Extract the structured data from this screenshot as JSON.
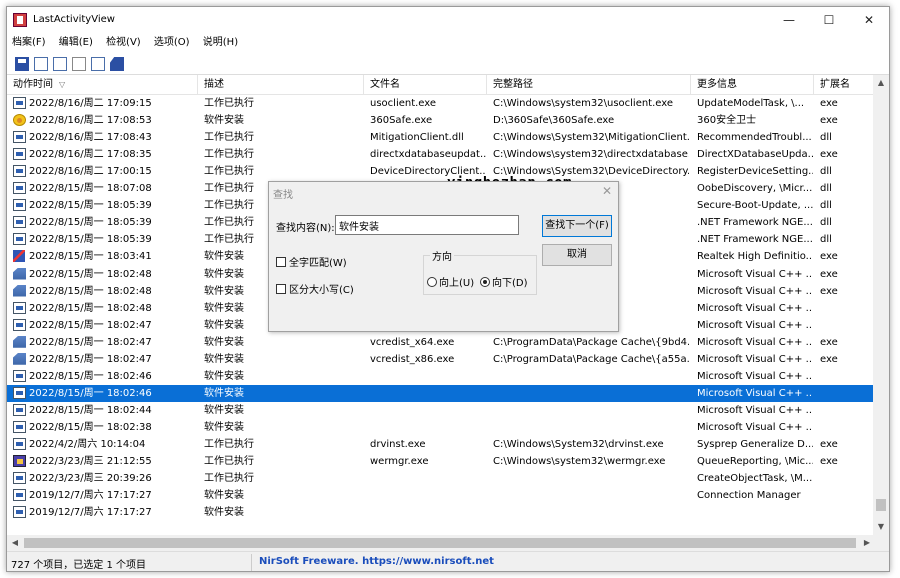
{
  "app": {
    "title": "LastActivityView"
  },
  "window_controls": {
    "minimize": "—",
    "maximize": "☐",
    "close": "✕"
  },
  "menu": [
    "档案(F)",
    "编辑(E)",
    "检视(V)",
    "选项(O)",
    "说明(H)"
  ],
  "toolbar": {
    "icons": [
      "save-icon",
      "properties-icon",
      "copy-icon",
      "html-report-icon",
      "export-icon",
      "exit-icon"
    ]
  },
  "columns": [
    "动作时间",
    "描述",
    "文件名",
    "完整路径",
    "更多信息",
    "扩展名"
  ],
  "sort_indicator": "▽",
  "rows": [
    {
      "icon": "app",
      "time": "2022/8/16/周二 17:09:15",
      "desc": "工作已执行",
      "file": "usoclient.exe",
      "path": "C:\\Windows\\system32\\usoclient.exe",
      "info": "UpdateModelTask, \\...",
      "ext": "exe"
    },
    {
      "icon": "s360",
      "time": "2022/8/16/周二 17:08:53",
      "desc": "软件安装",
      "file": "360Safe.exe",
      "path": "D:\\360Safe\\360Safe.exe",
      "info": "360安全卫士",
      "ext": "exe"
    },
    {
      "icon": "app",
      "time": "2022/8/16/周二 17:08:43",
      "desc": "工作已执行",
      "file": "MitigationClient.dll",
      "path": "C:\\Windows\\System32\\MitigationClient...",
      "info": "RecommendedTroubl...",
      "ext": "dll"
    },
    {
      "icon": "app",
      "time": "2022/8/16/周二 17:08:35",
      "desc": "工作已执行",
      "file": "directxdatabaseupdat...",
      "path": "C:\\Windows\\system32\\directxdatabase...",
      "info": "DirectXDatabaseUpda...",
      "ext": "exe"
    },
    {
      "icon": "app",
      "time": "2022/8/16/周二 17:00:15",
      "desc": "工作已执行",
      "file": "DeviceDirectoryClient...",
      "path": "C:\\Windows\\System32\\DeviceDirectory...",
      "info": "RegisterDeviceSetting...",
      "ext": "dll"
    },
    {
      "icon": "app",
      "time": "2022/8/15/周一 18:07:08",
      "desc": "工作已执行",
      "file": "",
      "path": "BMediaMana...",
      "info": "OobeDiscovery, \\Micr...",
      "ext": "dll"
    },
    {
      "icon": "app",
      "time": "2022/8/15/周一 18:05:39",
      "desc": "工作已执行",
      "file": "",
      "path": "mTasks.dll",
      "info": "Secure-Boot-Update, ...",
      "ext": "dll"
    },
    {
      "icon": "app",
      "time": "2022/8/15/周一 18:05:39",
      "desc": "工作已执行",
      "file": "",
      "path": "scoree.dll",
      "info": ".NET Framework NGE...",
      "ext": "dll"
    },
    {
      "icon": "app",
      "time": "2022/8/15/周一 18:05:39",
      "desc": "工作已执行",
      "file": "",
      "path": "scoree.dll",
      "info": ".NET Framework NGE...",
      "ext": "dll"
    },
    {
      "icon": "audio",
      "time": "2022/8/15/周一 18:03:41",
      "desc": "软件安装",
      "file": "",
      "path": "\\Audio\\HDA\\R...",
      "info": "Realtek High Definitio...",
      "ext": "exe"
    },
    {
      "icon": "setup",
      "time": "2022/8/15/周一 18:02:48",
      "desc": "软件安装",
      "file": "",
      "path": "e Cache\\{e1daf...",
      "info": "Microsoft Visual C++ ...",
      "ext": "exe"
    },
    {
      "icon": "setup",
      "time": "2022/8/15/周一 18:02:48",
      "desc": "软件安装",
      "file": "",
      "path": "e Cache\\{21f70...",
      "info": "Microsoft Visual C++ ...",
      "ext": "exe"
    },
    {
      "icon": "app",
      "time": "2022/8/15/周一 18:02:48",
      "desc": "软件安装",
      "file": "",
      "path": "",
      "info": "Microsoft Visual C++ ...",
      "ext": ""
    },
    {
      "icon": "app",
      "time": "2022/8/15/周一 18:02:47",
      "desc": "软件安装",
      "file": "",
      "path": "",
      "info": "Microsoft Visual C++ ...",
      "ext": ""
    },
    {
      "icon": "setup",
      "time": "2022/8/15/周一 18:02:47",
      "desc": "软件安装",
      "file": "vcredist_x64.exe",
      "path": "C:\\ProgramData\\Package Cache\\{9bd4...",
      "info": "Microsoft Visual C++ ...",
      "ext": "exe"
    },
    {
      "icon": "setup",
      "time": "2022/8/15/周一 18:02:47",
      "desc": "软件安装",
      "file": "vcredist_x86.exe",
      "path": "C:\\ProgramData\\Package Cache\\{a55a...",
      "info": "Microsoft Visual C++ ...",
      "ext": "exe"
    },
    {
      "icon": "app",
      "time": "2022/8/15/周一 18:02:46",
      "desc": "软件安装",
      "file": "",
      "path": "",
      "info": "Microsoft Visual C++ ...",
      "ext": ""
    },
    {
      "icon": "app",
      "time": "2022/8/15/周一 18:02:46",
      "desc": "软件安装",
      "file": "",
      "path": "",
      "info": "Microsoft Visual C++ ...",
      "ext": "",
      "selected": true
    },
    {
      "icon": "app",
      "time": "2022/8/15/周一 18:02:44",
      "desc": "软件安装",
      "file": "",
      "path": "",
      "info": "Microsoft Visual C++ ...",
      "ext": ""
    },
    {
      "icon": "app",
      "time": "2022/8/15/周一 18:02:38",
      "desc": "软件安装",
      "file": "",
      "path": "",
      "info": "Microsoft Visual C++ ...",
      "ext": ""
    },
    {
      "icon": "app",
      "time": "2022/4/2/周六 10:14:04",
      "desc": "工作已执行",
      "file": "drvinst.exe",
      "path": "C:\\Windows\\System32\\drvinst.exe",
      "info": "Sysprep Generalize D...",
      "ext": "exe"
    },
    {
      "icon": "wer",
      "time": "2022/3/23/周三 21:12:55",
      "desc": "工作已执行",
      "file": "wermgr.exe",
      "path": "C:\\Windows\\system32\\wermgr.exe",
      "info": "QueueReporting, \\Mic...",
      "ext": "exe"
    },
    {
      "icon": "app",
      "time": "2022/3/23/周三 20:39:26",
      "desc": "工作已执行",
      "file": "",
      "path": "",
      "info": "CreateObjectTask, \\M...",
      "ext": ""
    },
    {
      "icon": "app",
      "time": "2019/12/7/周六 17:17:27",
      "desc": "软件安装",
      "file": "",
      "path": "",
      "info": "Connection Manager",
      "ext": ""
    },
    {
      "icon": "app",
      "time": "2019/12/7/周六 17:17:27",
      "desc": "软件安装",
      "file": "",
      "path": "",
      "info": "",
      "ext": ""
    }
  ],
  "scroll": {
    "up": "▲",
    "down": "▼",
    "left": "◀",
    "right": "▶"
  },
  "status": {
    "count": "727 个项目，已选定 1 个项目",
    "credit": "NirSoft Freeware. https://www.nirsoft.net"
  },
  "dialog": {
    "title": "查找",
    "close": "✕",
    "find_label": "查找内容(N):",
    "find_value": "软件安装",
    "find_next": "查找下一个(F)",
    "cancel": "取消",
    "whole_word": "全字匹配(W)",
    "match_case": "区分大小写(C)",
    "direction_label": "方向",
    "dir_up": "向上(U)",
    "dir_down": "向下(D)",
    "direction": "down"
  },
  "watermark": "yinghezhan.com",
  "colors": {
    "selection": "#0a6fd6",
    "status_link": "#1a4dbb"
  }
}
